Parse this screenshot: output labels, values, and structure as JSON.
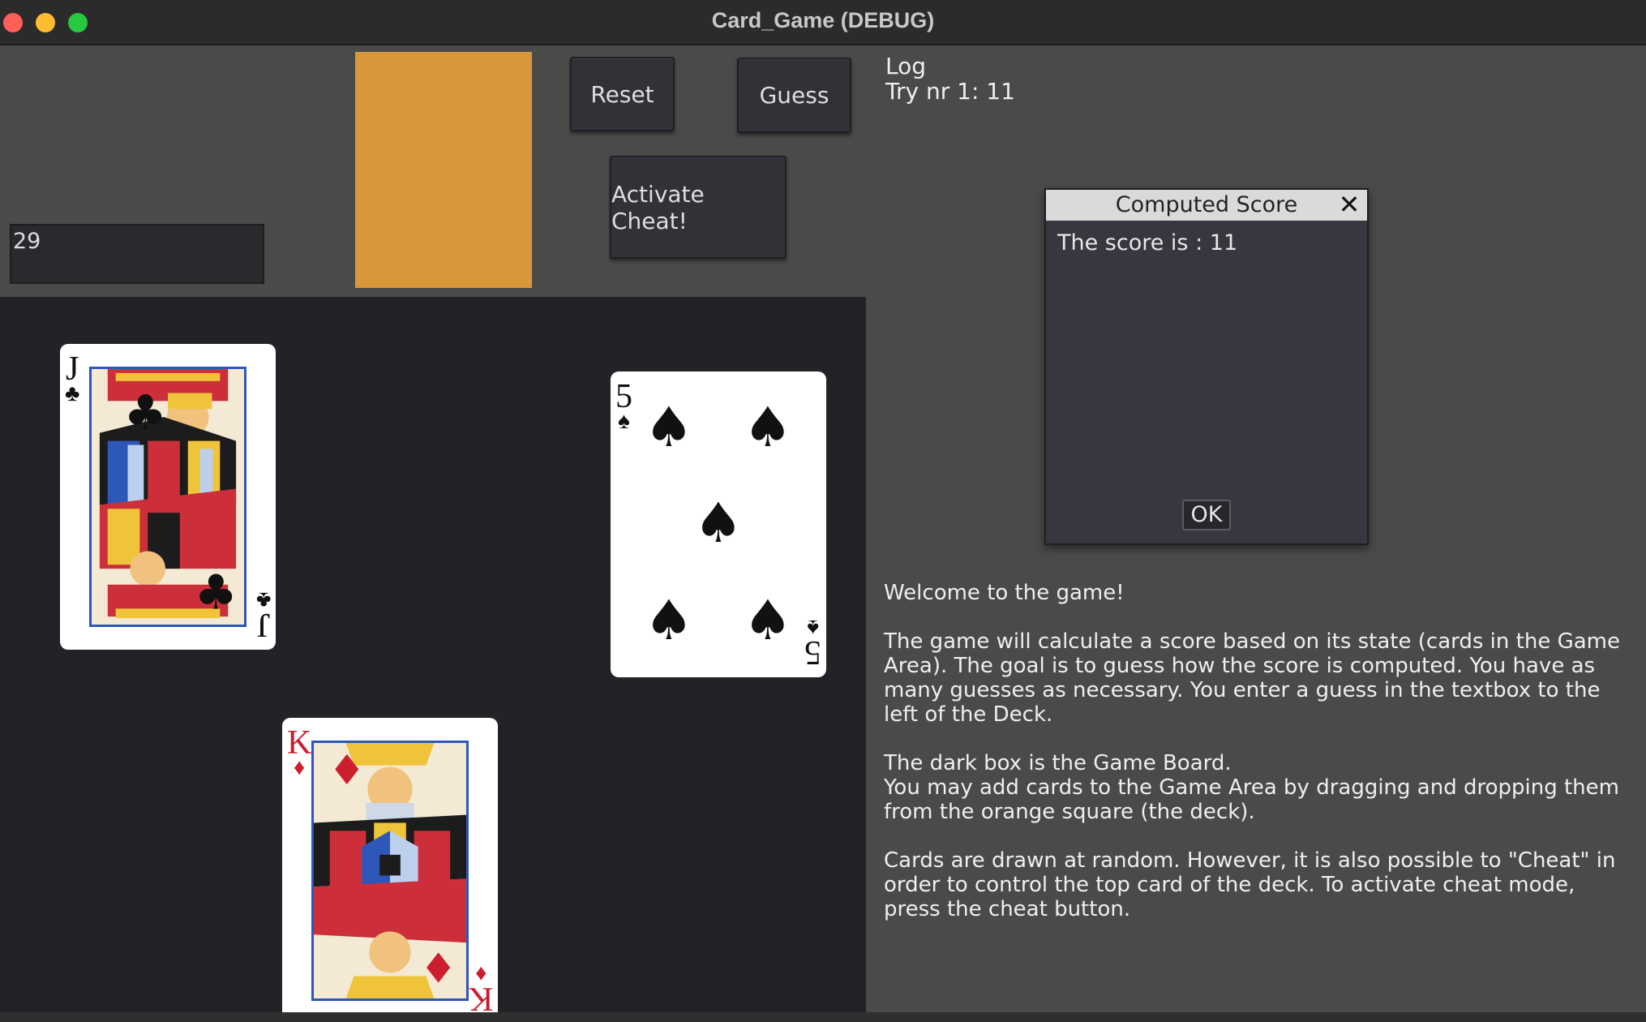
{
  "window": {
    "title": "Card_Game (DEBUG)"
  },
  "controls": {
    "guess_value": "29",
    "reset_label": "Reset",
    "guess_label": "Guess",
    "cheat_label": "Activate Cheat!",
    "deck_color": "#d9973a"
  },
  "log": {
    "title": "Log",
    "entries": [
      "Try nr 1: 11"
    ]
  },
  "board": {
    "cards": [
      {
        "rank": "J",
        "suit": "♣",
        "suit_name": "clubs",
        "color": "black"
      },
      {
        "rank": "5",
        "suit": "♠",
        "suit_name": "spades",
        "color": "black"
      },
      {
        "rank": "K",
        "suit": "♦",
        "suit_name": "diamonds",
        "color": "red"
      }
    ]
  },
  "dialog": {
    "title": "Computed Score",
    "close_glyph": "✕",
    "message": "The score is : 11",
    "ok_label": "OK"
  },
  "instructions": {
    "welcome": "Welcome to the game!",
    "p1": "The game will calculate a score based on its state (cards in the Game Area). The goal is to guess how the score is computed. You have as many guesses as necessary. You enter a guess in the textbox to the left of the Deck.",
    "p2a": "The dark box is the Game Board.",
    "p2b": "You may add cards to the Game Area by dragging and dropping them from the orange square (the deck).",
    "p3": "Cards are drawn at random. However, it is also possible to \"Cheat\" in order to control the top card of the deck. To activate cheat mode, press the cheat button."
  }
}
